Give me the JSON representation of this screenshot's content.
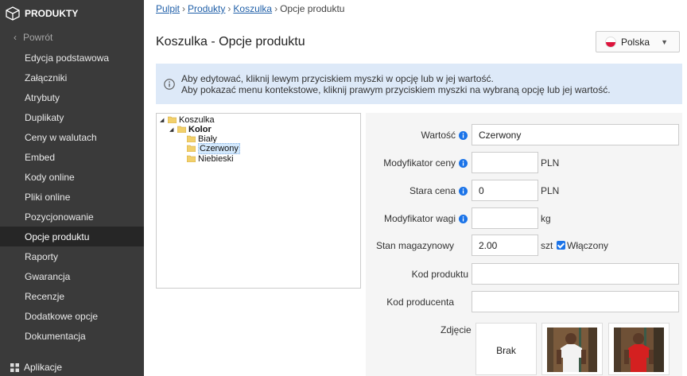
{
  "sidebar": {
    "brand": "PRODUKTY",
    "back_label": "Powrót",
    "items": [
      {
        "label": "Edycja podstawowa"
      },
      {
        "label": "Załączniki"
      },
      {
        "label": "Atrybuty"
      },
      {
        "label": "Duplikaty"
      },
      {
        "label": "Ceny w walutach"
      },
      {
        "label": "Embed"
      },
      {
        "label": "Kody online"
      },
      {
        "label": "Pliki online"
      },
      {
        "label": "Pozycjonowanie"
      },
      {
        "label": "Opcje produktu"
      },
      {
        "label": "Raporty"
      },
      {
        "label": "Gwarancja"
      },
      {
        "label": "Recenzje"
      },
      {
        "label": "Dodatkowe opcje"
      },
      {
        "label": "Dokumentacja"
      }
    ],
    "active_index": 9,
    "apps_label": "Aplikacje",
    "bg_color": "#3a3a3a",
    "active_color": "#262626"
  },
  "breadcrumb": {
    "items": [
      "Pulpit",
      "Produkty",
      "Koszulka"
    ],
    "current": "Opcje produktu"
  },
  "page": {
    "title": "Koszulka - Opcje produktu"
  },
  "language": {
    "selected": "Polska"
  },
  "info": {
    "line1": "Aby edytować, kliknij lewym przyciskiem myszki w opcję lub w jej wartość.",
    "line2": "Aby pokazać menu kontekstowe, kliknij prawym przyciskiem myszki na wybraną opcję lub jej wartość.",
    "bg_color": "#dde9f8"
  },
  "tree": {
    "root": "Koszulka",
    "group": "Kolor",
    "values": [
      "Biały",
      "Czerwony",
      "Niebieski"
    ],
    "selected": "Czerwony"
  },
  "form": {
    "wartosc": {
      "label": "Wartość",
      "value": "Czerwony"
    },
    "modyfikator_ceny": {
      "label": "Modyfikator ceny",
      "value": "",
      "unit": "PLN"
    },
    "stara_cena": {
      "label": "Stara cena",
      "value": "0",
      "unit": "PLN"
    },
    "modyfikator_wagi": {
      "label": "Modyfikator wagi",
      "value": "",
      "unit": "kg"
    },
    "stan_magazynowy": {
      "label": "Stan magazynowy",
      "value": "2.00",
      "unit": "szt",
      "checkbox_label": "Włączony",
      "checked": true
    },
    "kod_produktu": {
      "label": "Kod produktu",
      "value": ""
    },
    "kod_producenta": {
      "label": "Kod producenta",
      "value": ""
    },
    "zdjecie": {
      "label": "Zdjęcie",
      "none_label": "Brak",
      "photos": [
        "white-shirt-photo",
        "red-shirt-photo"
      ]
    }
  }
}
